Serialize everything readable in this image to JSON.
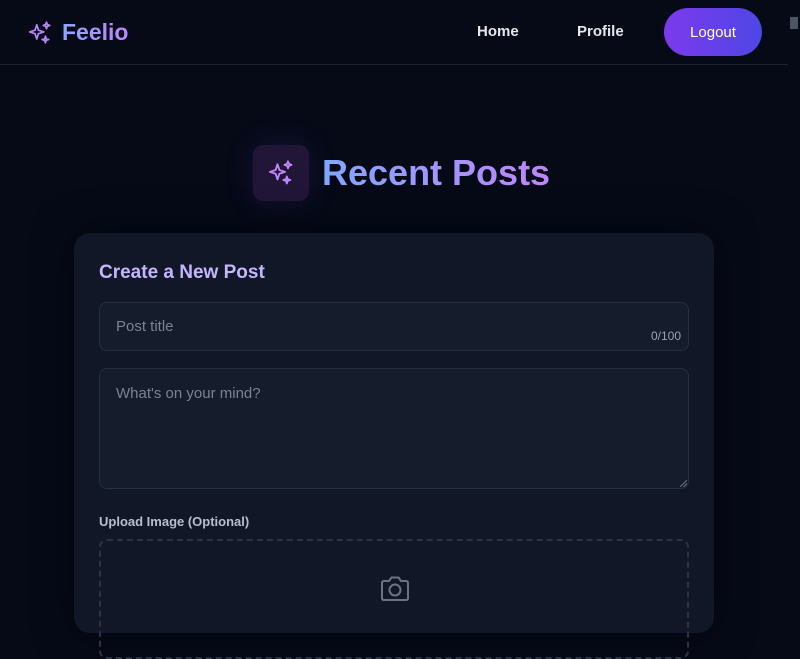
{
  "brand": {
    "name": "Feelio",
    "icon": "sparkles-icon"
  },
  "nav": {
    "home_label": "Home",
    "profile_label": "Profile",
    "logout_label": "Logout"
  },
  "heading": {
    "title": "Recent Posts",
    "icon": "sparkles-icon"
  },
  "composer": {
    "title": "Create a New Post",
    "title_placeholder": "Post title",
    "title_value": "",
    "char_count": "0/100",
    "body_placeholder": "What's on your mind?",
    "body_value": "",
    "upload_label": "Upload Image (Optional)",
    "upload_icon": "camera-icon"
  },
  "colors": {
    "background": "#060a17",
    "card": "#111726",
    "accent_purple": "#7c3aed",
    "accent_indigo": "#4f46e5",
    "brand_gradient_start": "#8aa6ff",
    "brand_gradient_end": "#c084fc"
  }
}
